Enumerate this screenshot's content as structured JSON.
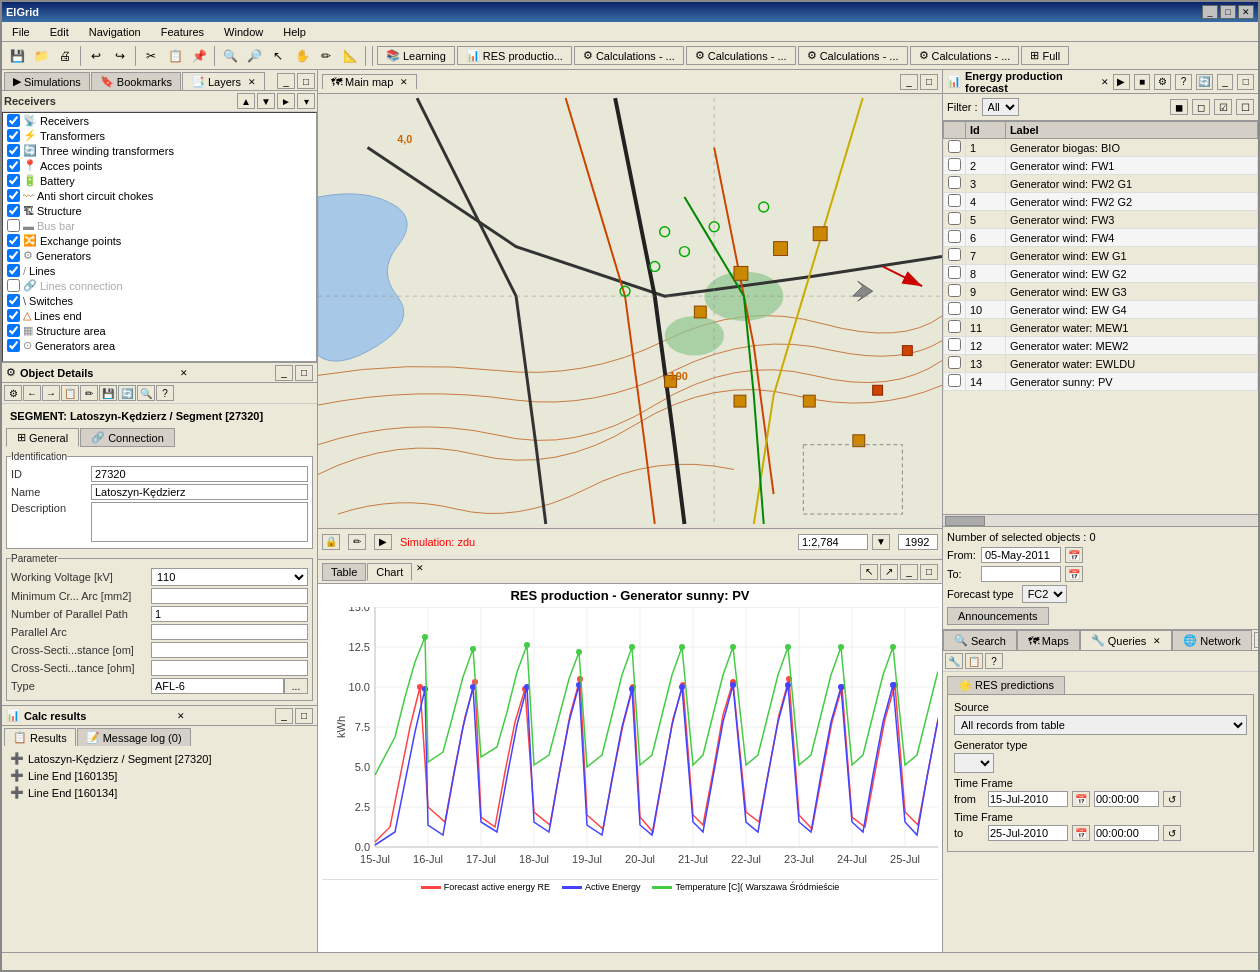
{
  "app": {
    "title": "ElGrid",
    "menu": [
      "File",
      "Edit",
      "Navigation",
      "Features",
      "Window",
      "Help"
    ]
  },
  "toolbar_tabs": [
    {
      "label": "Learning",
      "icon": "📚"
    },
    {
      "label": "RES productio...",
      "icon": "📊"
    },
    {
      "label": "Calculations - ...",
      "icon": "⚙"
    },
    {
      "label": "Calculations - ...",
      "icon": "⚙"
    },
    {
      "label": "Calculations - ...",
      "icon": "⚙"
    },
    {
      "label": "Calculations - ...",
      "icon": "⚙"
    },
    {
      "label": "Full",
      "icon": "⊞"
    }
  ],
  "left_panel": {
    "tabs": [
      "Simulations",
      "Bookmarks",
      "Layers"
    ],
    "active_tab": "Layers",
    "layers_title": "Receivers",
    "layers": [
      {
        "name": "Receivers",
        "checked": true,
        "icon": "📡"
      },
      {
        "name": "Transformers",
        "checked": true,
        "icon": "⚡"
      },
      {
        "name": "Three winding transformers",
        "checked": true,
        "icon": "🔄"
      },
      {
        "name": "Acces points",
        "checked": true,
        "icon": "📍"
      },
      {
        "name": "Battery",
        "checked": true,
        "icon": "🔋"
      },
      {
        "name": "Anti short circuit chokes",
        "checked": true,
        "icon": "〰"
      },
      {
        "name": "Structure",
        "checked": true,
        "icon": "🏗"
      },
      {
        "name": "Bus bar",
        "checked": false,
        "icon": "▬"
      },
      {
        "name": "Exchange points",
        "checked": true,
        "icon": "🔀"
      },
      {
        "name": "Generators",
        "checked": true,
        "icon": "⚙"
      },
      {
        "name": "Lines",
        "checked": true,
        "icon": "📏"
      },
      {
        "name": "Lines connection",
        "checked": false,
        "icon": "🔗"
      },
      {
        "name": "Switches",
        "checked": true,
        "icon": "🔌"
      },
      {
        "name": "Lines end",
        "checked": true,
        "icon": "📐"
      },
      {
        "name": "Structure area",
        "checked": true,
        "icon": "▦"
      },
      {
        "name": "Generators area",
        "checked": true,
        "icon": "⊙"
      }
    ]
  },
  "object_details": {
    "title": "Object Details",
    "segment_label": "SEGMENT: Latoszyn-Kędzierz / Segment [27320]",
    "tabs": [
      "General",
      "Connection"
    ],
    "active_tab": "General",
    "id_label": "ID",
    "id_value": "27320",
    "name_label": "Name",
    "name_value": "Latoszyn-Kędzierz",
    "desc_label": "Description",
    "desc_value": "",
    "param_group": "Parameter",
    "params": [
      {
        "label": "Working Voltage [kV]",
        "value": "110",
        "type": "select"
      },
      {
        "label": "Minimum Cr... Arc [mm2]",
        "value": "",
        "type": "text"
      },
      {
        "label": "Number of Parallel Path",
        "value": "1",
        "type": "text"
      },
      {
        "label": "Parallel Arc",
        "value": "",
        "type": "text"
      },
      {
        "label": "Cross-Secti...stance [om]",
        "value": "",
        "type": "text"
      },
      {
        "label": "Cross-Secti...tance [ohm]",
        "value": "",
        "type": "text"
      },
      {
        "label": "Type",
        "value": "AFL-6",
        "type": "text"
      }
    ]
  },
  "calc_results": {
    "title": "Calc results",
    "tabs": [
      "Results",
      "Message log (0)"
    ],
    "items": [
      {
        "label": "Latoszyn-Kędzierz / Segment [27320]"
      },
      {
        "label": "Line End [160135]"
      },
      {
        "label": "Line End [160134]"
      }
    ]
  },
  "map": {
    "title": "Main map",
    "simulation": "Simulation: zdu",
    "scale": "1:2,784",
    "year": "1992",
    "controls": [
      "↙↗",
      "🔍",
      "🔍-",
      "⊙",
      "◎"
    ]
  },
  "chart": {
    "title": "RES production - Generator sunny: PV",
    "tabs": [
      "Table",
      "Chart"
    ],
    "active_tab": "Chart",
    "x_labels": [
      "15-Jul",
      "16-Jul",
      "17-Jul",
      "18-Jul",
      "19-Jul",
      "20-Jul",
      "21-Jul",
      "22-Jul",
      "23-Jul",
      "24-Jul",
      "25-Jul"
    ],
    "y_left_min": 0.0,
    "y_left_max": 15.0,
    "y_right_min": 17.5,
    "y_right_max": 35.0,
    "y_left_label": "kWh",
    "legend": [
      {
        "label": "Forecast active energy RE",
        "color": "#ff4444"
      },
      {
        "label": "Active Energy",
        "color": "#4444ff"
      },
      {
        "label": "Temperature [C]( Warszawa Śródmieście",
        "color": "#44cc44"
      }
    ]
  },
  "energy_forecast": {
    "title": "Energy production forecast",
    "filter_label": "Filter :",
    "filter_value": "All",
    "table": {
      "headers": [
        "",
        "Id",
        "Label"
      ],
      "rows": [
        {
          "id": "1",
          "label": "Generator biogas: BIO"
        },
        {
          "id": "2",
          "label": "Generator wind: FW1"
        },
        {
          "id": "3",
          "label": "Generator wind: FW2 G1"
        },
        {
          "id": "4",
          "label": "Generator wind: FW2 G2"
        },
        {
          "id": "5",
          "label": "Generator wind: FW3"
        },
        {
          "id": "6",
          "label": "Generator wind: FW4"
        },
        {
          "id": "7",
          "label": "Generator wind: EW G1"
        },
        {
          "id": "8",
          "label": "Generator wind: EW G2"
        },
        {
          "id": "9",
          "label": "Generator wind: EW G3"
        },
        {
          "id": "10",
          "label": "Generator wind: EW G4"
        },
        {
          "id": "11",
          "label": "Generator water: MEW1"
        },
        {
          "id": "12",
          "label": "Generator water: MEW2"
        },
        {
          "id": "13",
          "label": "Generator water: EWLDU"
        },
        {
          "id": "14",
          "label": "Generator sunny: PV"
        }
      ]
    },
    "selected_count": "Number of selected objects : 0",
    "from_label": "From:",
    "from_value": "05-May-2011",
    "to_label": "To:",
    "to_value": "",
    "forecast_type_label": "Forecast type",
    "forecast_type_value": "FC2",
    "announcements_label": "Announcements"
  },
  "search_panel": {
    "tabs": [
      "Search",
      "Maps",
      "Queries",
      "Network"
    ],
    "active_tab": "Queries",
    "res_tab_label": "RES predictions",
    "source_label": "Source",
    "source_value": "All records from table",
    "gen_type_label": "Generator type",
    "gen_type_value": "",
    "timeframe_label": "Time Frame",
    "from_label": "from",
    "from_date": "15-Jul-2010",
    "from_time": "00:00:00",
    "to_label": "to",
    "to_date": "25-Jul-2010",
    "to_time": "00:00:00"
  }
}
